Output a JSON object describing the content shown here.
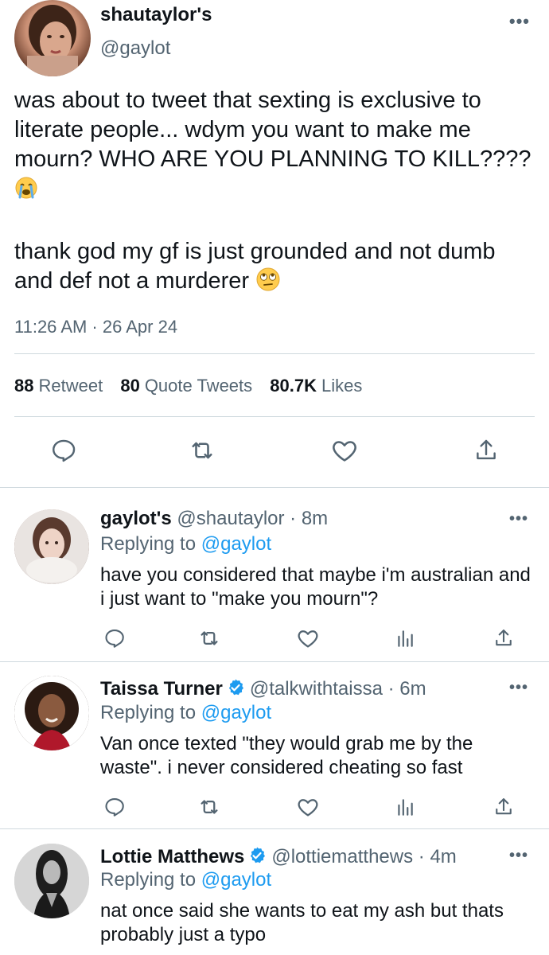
{
  "main_tweet": {
    "display_name": "shautaylor's",
    "handle": "@gaylot",
    "more": "•••",
    "text_line1": "was about to tweet that sexting is exclusive to literate people... wdym you want to make me mourn? WHO ARE YOU PLANNING TO KILL????",
    "text_line2": "thank god my gf is just grounded and not dumb and def not a murderer",
    "timestamp": "11:26 AM · 26 Apr 24",
    "stats": {
      "retweets": "88",
      "retweets_label": "Retweet",
      "quotes": "80",
      "quotes_label": "Quote Tweets",
      "likes": "80.7K",
      "likes_label": "Likes"
    }
  },
  "replies": [
    {
      "display_name": "gaylot's",
      "handle": "@shautaylor",
      "time": "· 8m",
      "verified": false,
      "replying_prefix": "Replying to",
      "replying_to": "@gaylot",
      "text": "have you considered that maybe i'm australian and i just want to \"make you mourn\"?",
      "more": "•••"
    },
    {
      "display_name": "Taissa Turner",
      "handle": "@talkwithtaissa",
      "time": "· 6m",
      "verified": true,
      "replying_prefix": "Replying to",
      "replying_to": "@gaylot",
      "text": "Van once texted \"they would grab me by the waste\". i never considered cheating so fast",
      "more": "•••"
    },
    {
      "display_name": "Lottie Matthews",
      "handle": "@lottiematthews",
      "time": "· 4m",
      "verified": true,
      "replying_prefix": "Replying to",
      "replying_to": "@gaylot",
      "text": "nat once said she wants to eat my ash but thats probably just a typo",
      "more": "•••"
    }
  ],
  "icons": {
    "reply": "reply-icon",
    "retweet": "retweet-icon",
    "like": "heart-icon",
    "share": "share-icon",
    "analytics": "analytics-icon",
    "verified": "verified-badge-icon",
    "emoji_crying": "loudly-crying-face-emoji",
    "emoji_eyeroll": "face-with-rolling-eyes-emoji"
  },
  "colors": {
    "text": "#0f1419",
    "secondary": "#536471",
    "accent": "#1d9bf0",
    "divider": "#cfd9de"
  }
}
